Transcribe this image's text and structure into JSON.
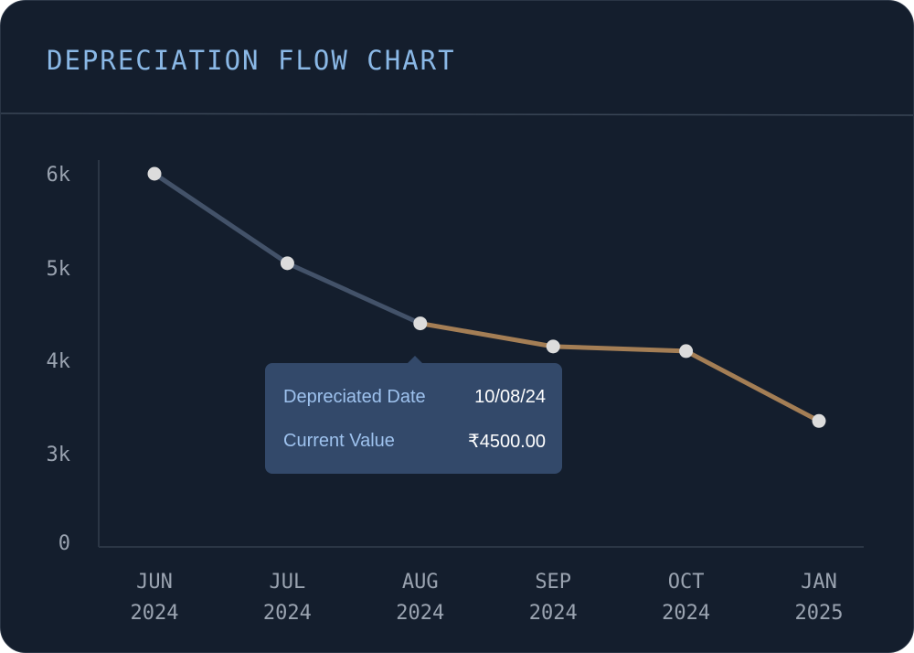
{
  "title": "DEPRECIATION FLOW CHART",
  "tooltip": {
    "date_label": "Depreciated Date",
    "date_value": "10/08/24",
    "value_label": "Current Value",
    "value_value": "₹4500.00"
  },
  "chart_data": {
    "type": "line",
    "title": "DEPRECIATION FLOW CHART",
    "x": [
      {
        "month": "JUN",
        "year": "2024"
      },
      {
        "month": "JUL",
        "year": "2024"
      },
      {
        "month": "AUG",
        "year": "2024"
      },
      {
        "month": "SEP",
        "year": "2024"
      },
      {
        "month": "OCT",
        "year": "2024"
      },
      {
        "month": "JAN",
        "year": "2025"
      }
    ],
    "values": [
      6000,
      5050,
      4400,
      4150,
      4100,
      3350
    ],
    "highlight_index": 2,
    "y_ticks": [
      {
        "value": 0,
        "label": "0"
      },
      {
        "value": 3000,
        "label": "3k"
      },
      {
        "value": 4000,
        "label": "4k"
      },
      {
        "value": 5000,
        "label": "5k"
      },
      {
        "value": 6000,
        "label": "6k"
      }
    ],
    "colors": {
      "past": "#435269",
      "future": "#a47e55",
      "point": "#dcdcdc",
      "axis": "#2b3645"
    },
    "grid": false,
    "legend": "none"
  }
}
